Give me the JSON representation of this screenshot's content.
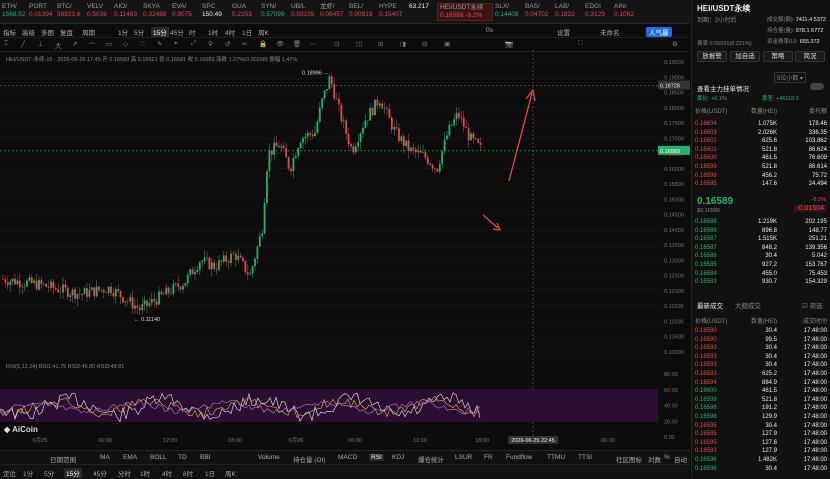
{
  "tickers": [
    {
      "name": "ETH/",
      "price": "1568.52",
      "color": "#26b26b"
    },
    {
      "name": "PORT",
      "price": "0.01394",
      "color": "#e5484d"
    },
    {
      "name": "BTC/",
      "price": "58923.6",
      "color": "#e5484d"
    },
    {
      "name": "VELV",
      "price": "0.5036",
      "color": "#e5484d"
    },
    {
      "name": "AIO/",
      "price": "0.11463",
      "color": "#e5484d"
    },
    {
      "name": "SKYA",
      "price": "0.32488",
      "color": "#e5484d"
    },
    {
      "name": "EVA/",
      "price": "0.9075",
      "color": "#e5484d"
    },
    {
      "name": "SPC",
      "price": "150.49",
      "color": "#eeeeee"
    },
    {
      "name": "GUA",
      "price": "0.2253",
      "color": "#e5484d"
    },
    {
      "name": "SYN/",
      "price": "0.57099",
      "color": "#26b26b"
    },
    {
      "name": "UB/L",
      "price": "0.03155",
      "color": "#e5484d"
    },
    {
      "name": "龙虾/",
      "price": "0.08457",
      "color": "#e5484d"
    },
    {
      "name": "BEL/",
      "price": "0.00919",
      "color": "#e5484d"
    },
    {
      "name": "HYPE",
      "price": "0.15407",
      "color": "#e5484d"
    },
    {
      "name": "",
      "price": "63.217",
      "color": "#eeeeee"
    },
    {
      "name": "HEI/USDT永续",
      "price": "0.16589 -8.2%",
      "color": "#e5484d",
      "active": true
    },
    {
      "name": "SLX/",
      "price": "0.14408",
      "color": "#26b26b"
    },
    {
      "name": "BAS/",
      "price": "0.04702",
      "color": "#e5484d"
    },
    {
      "name": "LAB/",
      "price": "0.1822",
      "color": "#e5484d"
    },
    {
      "name": "EDGI",
      "price": "0.3129",
      "color": "#e5484d"
    },
    {
      "name": "AIN/",
      "price": "0.10820",
      "color": "#e5484d"
    }
  ],
  "toolbar1": {
    "items": [
      "指标",
      "高级",
      "多图",
      "复盘",
      "周期",
      "1分",
      "5分",
      "15分",
      "45分",
      "时",
      "1时",
      "4时",
      "1日",
      "周K"
    ],
    "selected": "15分",
    "right": [
      "0s",
      "设置",
      "未命名",
      "人气暴"
    ]
  },
  "toolbar2": {
    "items": [
      "1分",
      "5分",
      "15分",
      "45分",
      "分时",
      "1时",
      "4时",
      "8时",
      "1日",
      "周K"
    ]
  },
  "chart_info": "HEI/USDT·永续·15 · 2026-06-26 17:45 开 0.16583 高 0.16621 低 0.16581 收 0.16589 涨跌 1.27%(0.00208) 振幅 1.47%",
  "rsi_info": "RSI(6,12,24) RSI1:41.75 RSI2:46.80 RSI3:48.81",
  "chart_data": {
    "type": "candlestick",
    "symbol": "HEI/USDT永续",
    "interval": "15分",
    "ylim": [
      0.099,
      0.195
    ],
    "y_ticks": [
      "0.19500",
      "0.19000",
      "0.18500",
      "0.18000",
      "0.17500",
      "0.17000",
      "0.16500",
      "0.16000",
      "0.15500",
      "0.15000",
      "0.14500",
      "0.14000",
      "0.13500",
      "0.13000",
      "0.12500",
      "0.12000",
      "0.11500",
      "0.11000",
      "0.10500",
      "0.10000"
    ],
    "x_ticks": [
      "6月25",
      "06:00",
      "12:00",
      "18:00",
      "6月26",
      "06:00",
      "12:00",
      "18:00",
      "2026-06-25 22:45",
      "06:00"
    ],
    "last_price": "0.16589",
    "crosshair_price": "0.18728",
    "high_label": "0.18996",
    "low_label": "0.11140",
    "rsi_ticks": [
      "80.00",
      "60.00",
      "40.00",
      "20.00",
      "0.00"
    ]
  },
  "watermark": "AiCoin",
  "bottom": {
    "left": [
      "定位",
      "1分",
      "5分",
      "15分",
      "45分",
      "分时",
      "1时",
      "4时",
      "8时",
      "1日",
      "周K"
    ],
    "tabs": [
      "日期范围",
      "MA",
      "EMA",
      "BOLL",
      "TD",
      "BBI",
      "Volume",
      "持仓量 (OI)",
      "MACD",
      "RSI",
      "KDJ",
      "爆仓统计",
      "LSUR",
      "FR",
      "Fundflow",
      "TTMU",
      "TTSI",
      "社区图标",
      "对数",
      "%",
      "自动"
    ],
    "selected_tab": "RSI"
  },
  "right": {
    "title": "HEI/USDT永续",
    "subtitle": "到期：2小时后",
    "stats": [
      {
        "k": "成交额(额)",
        "v": "7411.4 5372"
      },
      {
        "k": "持仓量(量)",
        "v": "978.1 6772"
      },
      {
        "k": "资金费率(U)",
        "v": "655.372"
      }
    ],
    "rate_line": "费率 0.00031(0.221%)",
    "buttons": [
      "放报警",
      "加自选",
      "策略",
      "简況"
    ],
    "precision": "5位小数",
    "depth_title": "查看主力挂单情况",
    "ratio": {
      "left": "委比: +0.1%",
      "right": "委差: +46118.3"
    },
    "ob_headers": [
      "价格(USDT)",
      "数量(HEI)",
      "委托额"
    ],
    "asks": [
      [
        "0.16604",
        "1.075K",
        "178.46"
      ],
      [
        "0.16603",
        "2.026K",
        "336.35"
      ],
      [
        "0.16602",
        "625.6",
        "103.862"
      ],
      [
        "0.16601",
        "521.8",
        "86.624"
      ],
      [
        "0.16600",
        "461.5",
        "76.609"
      ],
      [
        "0.16599",
        "521.8",
        "86.614"
      ],
      [
        "0.16598",
        "456.2",
        "75.72"
      ],
      [
        "0.16595",
        "147.6",
        "24.494"
      ]
    ],
    "mid_price": "0.16589",
    "mid_sub": "$0.16589",
    "mid_change": "-8.2%",
    "mid_change2": "-0.01504",
    "bids": [
      [
        "0.16588",
        "1.219K",
        "202.195"
      ],
      [
        "0.16588",
        "896.8",
        "148.77"
      ],
      [
        "0.16587",
        "1.515K",
        "251.21"
      ],
      [
        "0.16587",
        "848.2",
        "139.356"
      ],
      [
        "0.16586",
        "30.4",
        "5.042"
      ],
      [
        "0.16585",
        "927.2",
        "153.767"
      ],
      [
        "0.16584",
        "455.0",
        "75.453"
      ],
      [
        "0.16583",
        "930.7",
        "154.329"
      ]
    ],
    "trades_tabs": [
      "最新成交",
      "大额成交",
      "筛选"
    ],
    "trades_headers": [
      "价格(USDT)",
      "数量(HEI)",
      "成交时间"
    ],
    "trades": [
      [
        "0.16590",
        "30.4",
        "17:48:00"
      ],
      [
        "0.16590",
        "99.5",
        "17:48:00"
      ],
      [
        "0.16593",
        "30.4",
        "17:48:00"
      ],
      [
        "0.16593",
        "30.4",
        "17:48:00"
      ],
      [
        "0.16593",
        "30.4",
        "17:48:00"
      ],
      [
        "0.16593",
        "625.2",
        "17:48:00"
      ],
      [
        "0.16594",
        "884.9",
        "17:48:00"
      ],
      [
        "0.16600",
        "461.5",
        "17:48:00"
      ],
      [
        "0.16598",
        "521.8",
        "17:48:00"
      ],
      [
        "0.16598",
        "191.2",
        "17:48:00"
      ],
      [
        "0.16598",
        "129.9",
        "17:48:00"
      ],
      [
        "0.16595",
        "30.4",
        "17:48:00"
      ],
      [
        "0.16595",
        "127.9",
        "17:48:00"
      ],
      [
        "0.16595",
        "127.6",
        "17:48:00"
      ],
      [
        "0.16593",
        "127.9",
        "17:48:00"
      ],
      [
        "0.16596",
        "1.482K",
        "17:48:00"
      ],
      [
        "0.16596",
        "30.4",
        "17:48:00"
      ]
    ]
  }
}
